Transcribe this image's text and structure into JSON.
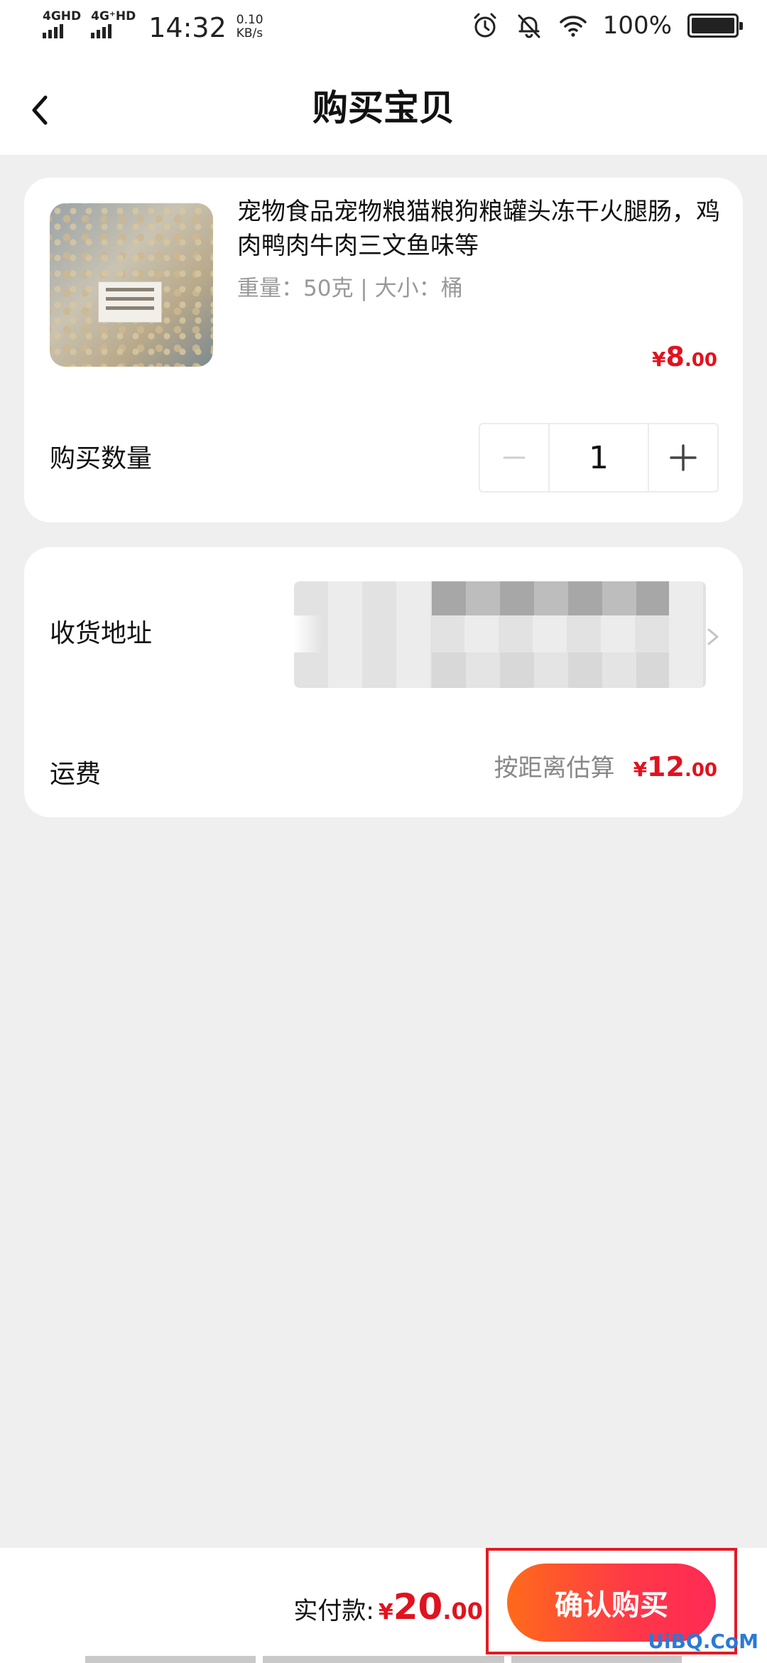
{
  "status_bar": {
    "network_1": "4GHD",
    "network_2": "4G⁺HD",
    "time": "14:32",
    "speed_value": "0.10",
    "speed_unit": "KB/s",
    "battery": "100%"
  },
  "header": {
    "title": "购买宝贝"
  },
  "product": {
    "name": "宠物食品宠物粮猫粮狗粮罐头冻干火腿肠，鸡肉鸭肉牛肉三文鱼味等",
    "spec": "重量：50克 | 大小：桶",
    "price_symbol": "¥",
    "price_int": "8",
    "price_dec": ".00",
    "quantity_label": "购买数量",
    "quantity": "1",
    "thumb_icon": "product-photo"
  },
  "address": {
    "label": "收货地址",
    "arrow_icon": "chevron-right-icon"
  },
  "shipping": {
    "label": "运费",
    "note": "按距离估算",
    "price_symbol": "¥",
    "price_int": "12",
    "price_dec": ".00"
  },
  "footer": {
    "pay_label": "实付款:",
    "price_symbol": "¥",
    "price_int": "20",
    "price_dec": ".00",
    "confirm_label": "确认购买"
  },
  "watermark": "UiBQ.CoM",
  "colors": {
    "accent_red": "#e0131f",
    "button_gradient_start": "#ff6a1a",
    "button_gradient_end": "#ff2a55",
    "highlight_border": "#e31b23",
    "page_bg": "#efefef"
  }
}
